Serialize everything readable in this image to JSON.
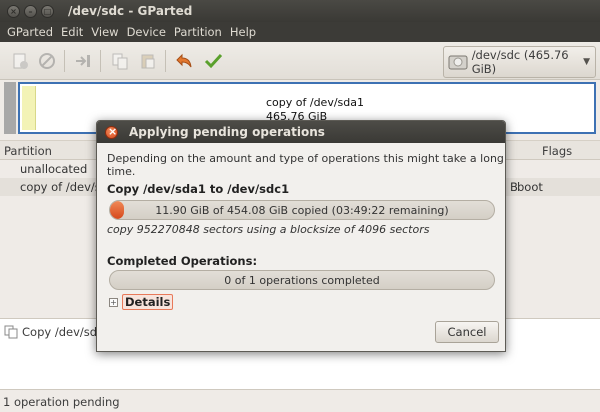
{
  "window": {
    "title": "/dev/sdc - GParted"
  },
  "menubar": [
    "GParted",
    "Edit",
    "View",
    "Device",
    "Partition",
    "Help"
  ],
  "toolbar": {
    "items": [
      {
        "icon": "new-partition-icon",
        "enabled": false
      },
      {
        "icon": "delete-icon",
        "enabled": false
      },
      {
        "icon": "resize-move-icon",
        "enabled": false
      },
      {
        "icon": "copy-icon",
        "enabled": false
      },
      {
        "icon": "paste-icon",
        "enabled": false
      },
      {
        "icon": "undo-icon",
        "enabled": true
      },
      {
        "icon": "apply-icon",
        "enabled": true
      }
    ],
    "device": {
      "label": "/dev/sdc   (465.76 GiB)",
      "icon": "disk-icon"
    }
  },
  "partition_bar": {
    "name": "copy of /dev/sda1",
    "size": "465.76 GiB"
  },
  "list": {
    "headers": {
      "partition": "Partition",
      "flags": "Flags"
    },
    "rows": [
      {
        "partition": "unallocated",
        "tail": "",
        "flags": ""
      },
      {
        "partition": "copy of /dev/sd",
        "tail": "B",
        "flags": "boot"
      }
    ]
  },
  "queue": {
    "item": "Copy /dev/sda1"
  },
  "status": {
    "text": "1 operation pending"
  },
  "dialog": {
    "title": "Applying pending operations",
    "description": "Depending on the amount and type of operations this might take a long time.",
    "operation_title": "Copy /dev/sda1 to /dev/sdc1",
    "operation_progress": {
      "text": "11.90 GiB of 454.08 GiB copied (03:49:22 remaining)",
      "fraction": 0.026
    },
    "operation_detail": "copy 952270848 sectors using a blocksize of 4096 sectors",
    "completed_label": "Completed Operations:",
    "completed_progress": {
      "text": "0 of 1 operations completed",
      "fraction": 0
    },
    "details_label": "Details",
    "cancel_label": "Cancel"
  },
  "colors": {
    "accent": "#dd4814",
    "selection_border": "#3d71b3",
    "partition_fill": "#f3f3b6"
  }
}
